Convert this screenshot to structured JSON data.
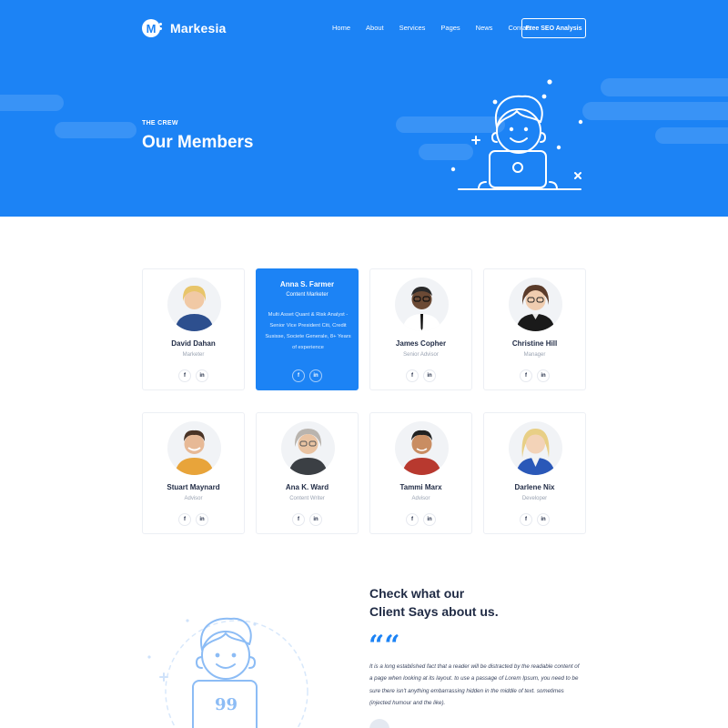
{
  "brand": {
    "logo_letter": "M",
    "name": "Markesia"
  },
  "nav": {
    "items": [
      "Home",
      "About",
      "Services",
      "Pages",
      "News",
      "Contact"
    ],
    "cta": "Free SEO Analysis"
  },
  "hero": {
    "eyebrow": "THE CREW",
    "title": "Our Members"
  },
  "colors": {
    "primary": "#1c83f5",
    "text": "#1f2a44",
    "muted": "#9aa3b2"
  },
  "members": [
    {
      "name": "David Dahan",
      "role": "Marketer",
      "skin": "#f1c9a5",
      "hair": "#e8c56a",
      "shirt": "#2d4f8e"
    },
    {
      "name": "Anna S. Farmer",
      "role": "Content Marketer",
      "bio": "Multi Asset Quant & Risk Analyst - Senior Vice President Citi, Credit Susisse, Societe Generale, 8+ Years of experience",
      "active": true
    },
    {
      "name": "James Copher",
      "role": "Senior Advisor",
      "skin": "#6b4a35",
      "hair": "#2a2a2a",
      "shirt": "#ffffff"
    },
    {
      "name": "Christine Hill",
      "role": "Manager",
      "skin": "#f0cdb0",
      "hair": "#5a3b2a",
      "shirt": "#1a1a1a"
    },
    {
      "name": "Stuart Maynard",
      "role": "Advisor",
      "skin": "#e7b996",
      "hair": "#4a3426",
      "shirt": "#e8a43a"
    },
    {
      "name": "Ana K. Ward",
      "role": "Content Writer",
      "skin": "#e9c3a2",
      "hair": "#b9b4ae",
      "shirt": "#3b3f44"
    },
    {
      "name": "Tammi Marx",
      "role": "Advisor",
      "skin": "#c98d62",
      "hair": "#222222",
      "shirt": "#b8392f"
    },
    {
      "name": "Darlene Nix",
      "role": "Developer",
      "skin": "#f3d3b8",
      "hair": "#e8cf86",
      "shirt": "#2a58b8"
    }
  ],
  "social": {
    "facebook": "f",
    "linkedin": "in"
  },
  "testimonial": {
    "title_line1": "Check what our",
    "title_line2": "Client Says about us.",
    "quote_mark": "““",
    "text": "It is a long established fact that a reader will be distracted by the readable content of a page when looking at its layout. to use a passage of Lorem Ipsum, you need to be sure there isn't anything embarrassing hidden in the middle of text. sometimes (injected humour and the like).",
    "art_quote": "99"
  }
}
